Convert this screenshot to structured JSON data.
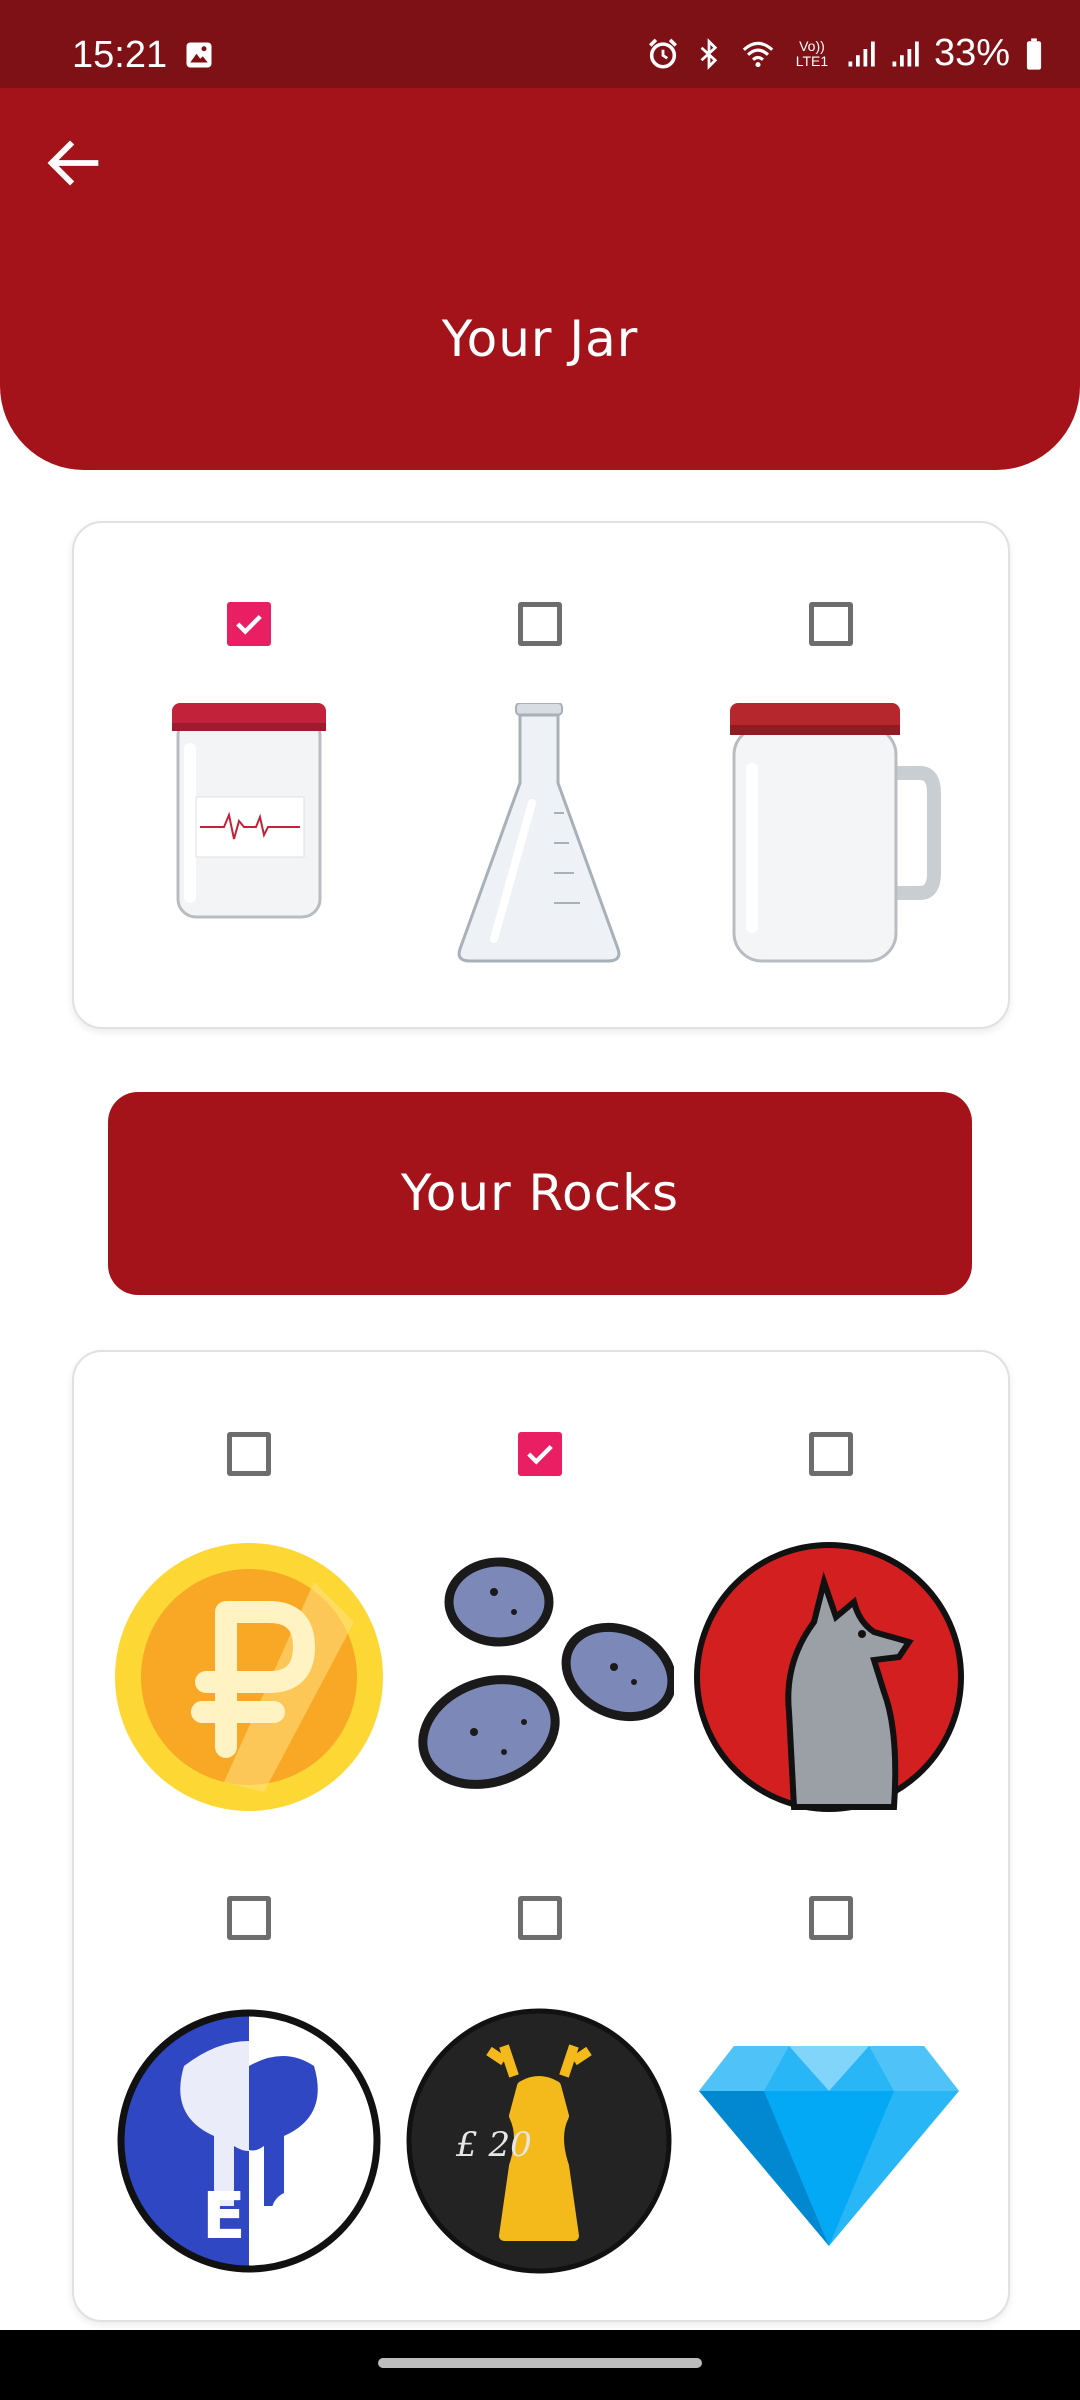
{
  "status_bar": {
    "time": "15:21",
    "network_label": "Vo)) LTE1",
    "battery": "33%",
    "icons": [
      "gallery-icon",
      "alarm-icon",
      "bluetooth-icon",
      "wifi-icon",
      "volte-icon",
      "signal-icon",
      "signal-icon",
      "battery-icon"
    ]
  },
  "header": {
    "back_icon": "arrow-back-icon",
    "title": "Your Jar"
  },
  "jars": [
    {
      "name": "glass-jar-with-red-lid",
      "checked": true
    },
    {
      "name": "erlenmeyer-flask",
      "checked": false
    },
    {
      "name": "mason-jar-mug",
      "checked": false
    }
  ],
  "rocks_button": {
    "label": "Your Rocks"
  },
  "rocks": [
    {
      "name": "ruble-coin",
      "checked": false
    },
    {
      "name": "blue-rocks",
      "checked": true
    },
    {
      "name": "howling-wolf-badge",
      "checked": false
    },
    {
      "name": "eg-elephant-badge",
      "checked": false,
      "text": "E G"
    },
    {
      "name": "stag-badge",
      "checked": false,
      "text": "£ 20"
    },
    {
      "name": "blue-diamond",
      "checked": false
    }
  ],
  "colors": {
    "primary": "#a4131a",
    "status_bar": "#7d1115",
    "checkbox_checked": "#e91e63",
    "checkbox_unchecked": "#6d6d6d"
  }
}
